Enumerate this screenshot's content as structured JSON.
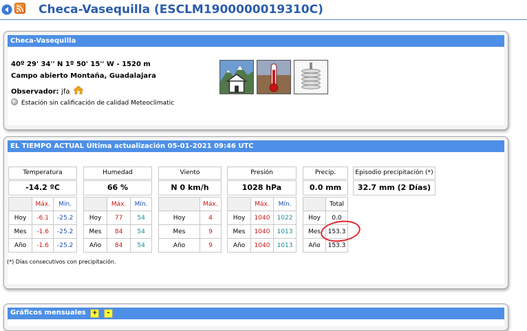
{
  "header": {
    "title": "Checa-Vasequilla (ESCLM1900000019310C)"
  },
  "station": {
    "panel_title": "Checa-Vasequilla",
    "coords": "40º 29' 34'' N   1º 50' 15'' W  -  1520 m",
    "place": "Campo abierto Montaña, Guadalajara",
    "observer_label": "Observador:",
    "observer_name": "jfa",
    "quality": "Estación sin calificación de calidad Meteoclimatic",
    "images": [
      "mountain-house",
      "thermometer",
      "radiation-shield"
    ]
  },
  "weather": {
    "panel_title": "EL TIEMPO ACTUAL Última actualización 05-01-2021 09:46 UTC",
    "columns": [
      {
        "label": "Temperatura",
        "current": "-14.2 ºC"
      },
      {
        "label": "Humedad",
        "current": "66 %"
      },
      {
        "label": "Viento",
        "current": "N  0 km/h"
      },
      {
        "label": "Presión",
        "current": "1028 hPa"
      },
      {
        "label": "Precip.",
        "current": "0.0 mm"
      },
      {
        "label": "Episodio precipitación (*)",
        "current": "32.7 mm (2 Días)"
      }
    ],
    "stats_headers": {
      "max": "Máx.",
      "min": "Mín.",
      "total": "Total"
    },
    "row_labels": [
      "Hoy",
      "Mes",
      "Año"
    ],
    "temperature": [
      [
        "-6.1",
        "-25.2"
      ],
      [
        "-1.6",
        "-25.2"
      ],
      [
        "-1.6",
        "-25.2"
      ]
    ],
    "humidity": [
      [
        "77",
        "54"
      ],
      [
        "84",
        "54"
      ],
      [
        "84",
        "54"
      ]
    ],
    "wind": [
      "4",
      "9",
      "9"
    ],
    "pressure": [
      [
        "1040",
        "1022"
      ],
      [
        "1040",
        "1013"
      ],
      [
        "1040",
        "1013"
      ]
    ],
    "precip": [
      "0.0",
      "153.3",
      "153.3"
    ],
    "note": "(*) Días consecutivos con precipitación."
  },
  "charts": {
    "panel_title": "Gráficos mensuales",
    "plus": "+",
    "minus": "-"
  },
  "colors": {
    "header_blue": "#4d8fe6",
    "title_blue": "#2a5caa",
    "max_red": "#c81414",
    "min_blue": "#1c4fb0",
    "annotation_red": "#e0232a"
  }
}
